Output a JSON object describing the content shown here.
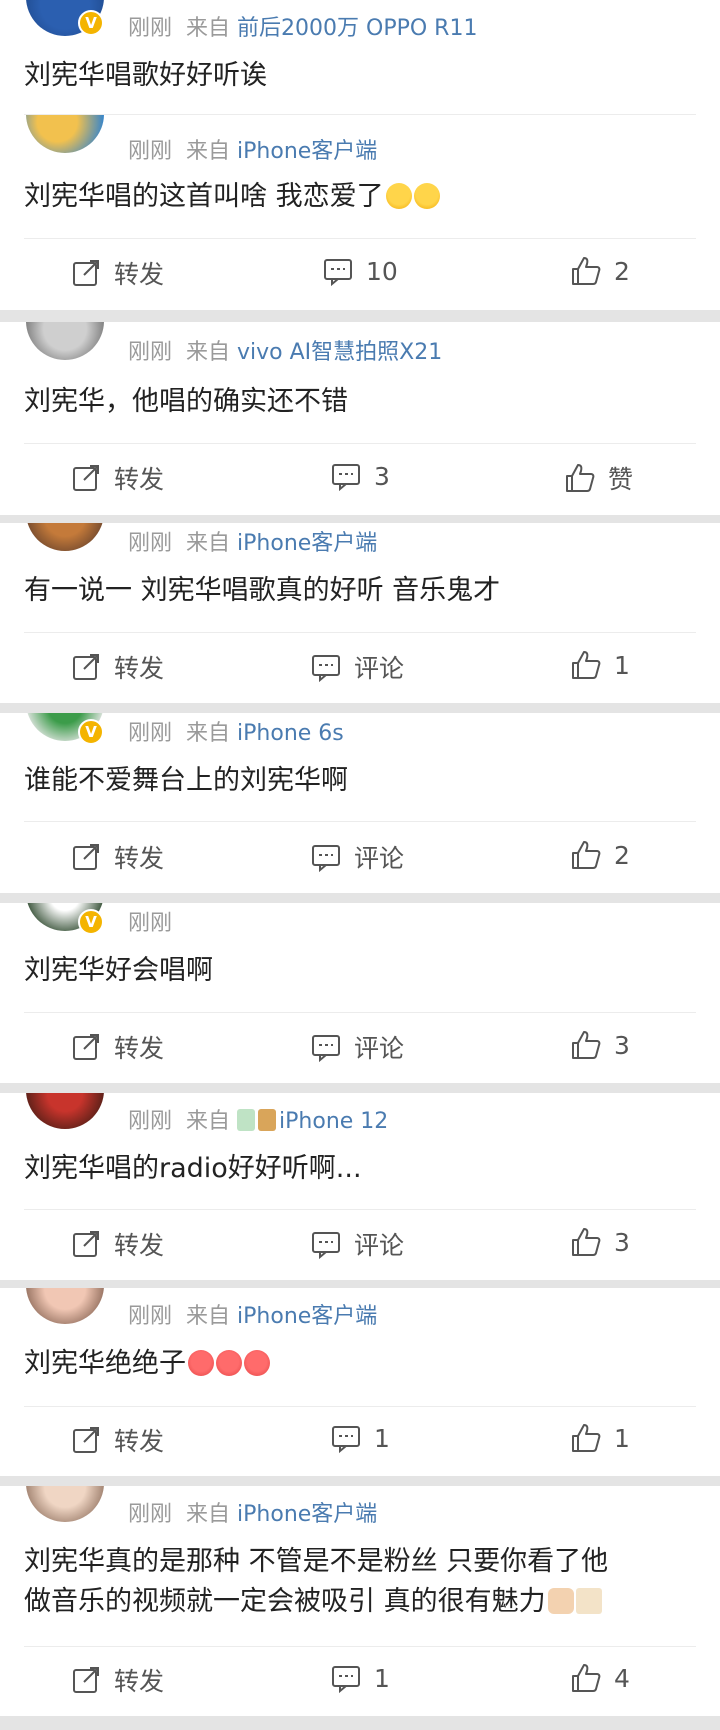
{
  "labels": {
    "time_just_now": "刚刚",
    "from": "来自",
    "repost": "转发",
    "comment": "评论",
    "like": "赞"
  },
  "icons": [
    "repost-icon",
    "comment-icon",
    "like-icon",
    "verified-badge-icon"
  ],
  "colors": {
    "source": "#4a7bb0",
    "meta": "#9a9a9a",
    "text": "#222222",
    "badge": "#f4b400"
  },
  "posts": [
    {
      "time": "刚刚",
      "from": "来自",
      "source": "前后2000万 OPPO R11",
      "text": "刘宪华唱歌好好听诶",
      "verified": true
    },
    {
      "time": "刚刚",
      "from": "来自",
      "source": "iPhone客户端",
      "text": "刘宪华唱的这首叫啥 我恋爱了",
      "repost": "转发",
      "comments": "10",
      "likes": "2"
    },
    {
      "time": "刚刚",
      "from": "来自",
      "source": "vivo AI智慧拍照X21",
      "text": "刘宪华，他唱的确实还不错",
      "repost": "转发",
      "comments": "3",
      "likes": "赞"
    },
    {
      "time": "刚刚",
      "from": "来自",
      "source": "iPhone客户端",
      "text": "有一说一 刘宪华唱歌真的好听 音乐鬼才",
      "repost": "转发",
      "comments": "评论",
      "likes": "1"
    },
    {
      "time": "刚刚",
      "from": "来自",
      "source": "iPhone 6s",
      "text": "谁能不爱舞台上的刘宪华啊",
      "repost": "转发",
      "comments": "评论",
      "likes": "2",
      "verified": true
    },
    {
      "time": "刚刚",
      "text": "刘宪华好会唱啊",
      "repost": "转发",
      "comments": "评论",
      "likes": "3",
      "verified": true
    },
    {
      "time": "刚刚",
      "from": "来自",
      "source": "iPhone 12",
      "text": "刘宪华唱的radio好好听啊...",
      "repost": "转发",
      "comments": "评论",
      "likes": "3"
    },
    {
      "time": "刚刚",
      "from": "来自",
      "source": "iPhone客户端",
      "text": "刘宪华绝绝子",
      "repost": "转发",
      "comments": "1",
      "likes": "1"
    },
    {
      "time": "刚刚",
      "from": "来自",
      "source": "iPhone客户端",
      "text": "刘宪华真的是那种 不管是不是粉丝 只要你看了他\n做音乐的视频就一定会被吸引 真的很有魅力",
      "repost": "转发",
      "comments": "1",
      "likes": "4"
    }
  ]
}
